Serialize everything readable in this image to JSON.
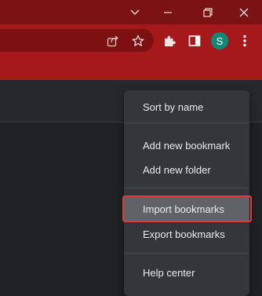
{
  "browser": {
    "avatar_letter": "S",
    "avatar_color": "#0f8a78",
    "frame_color": "#7b1213",
    "toolbar_color": "#a5191b",
    "icons": {
      "tab_search": "chevron-down-icon",
      "restore": "restore-icon",
      "close": "close-icon",
      "share": "share-icon",
      "bookmark": "star-icon",
      "extensions": "puzzle-icon",
      "side_panel": "side-panel-icon",
      "menu": "kebab-menu-icon"
    }
  },
  "menu": {
    "items": [
      {
        "label": "Sort by name"
      },
      {
        "label": "Add new bookmark"
      },
      {
        "label": "Add new folder"
      },
      {
        "label": "Import bookmarks",
        "highlighted": true
      },
      {
        "label": "Export bookmarks"
      },
      {
        "label": "Help center"
      }
    ],
    "highlight_color": "#e53935"
  }
}
